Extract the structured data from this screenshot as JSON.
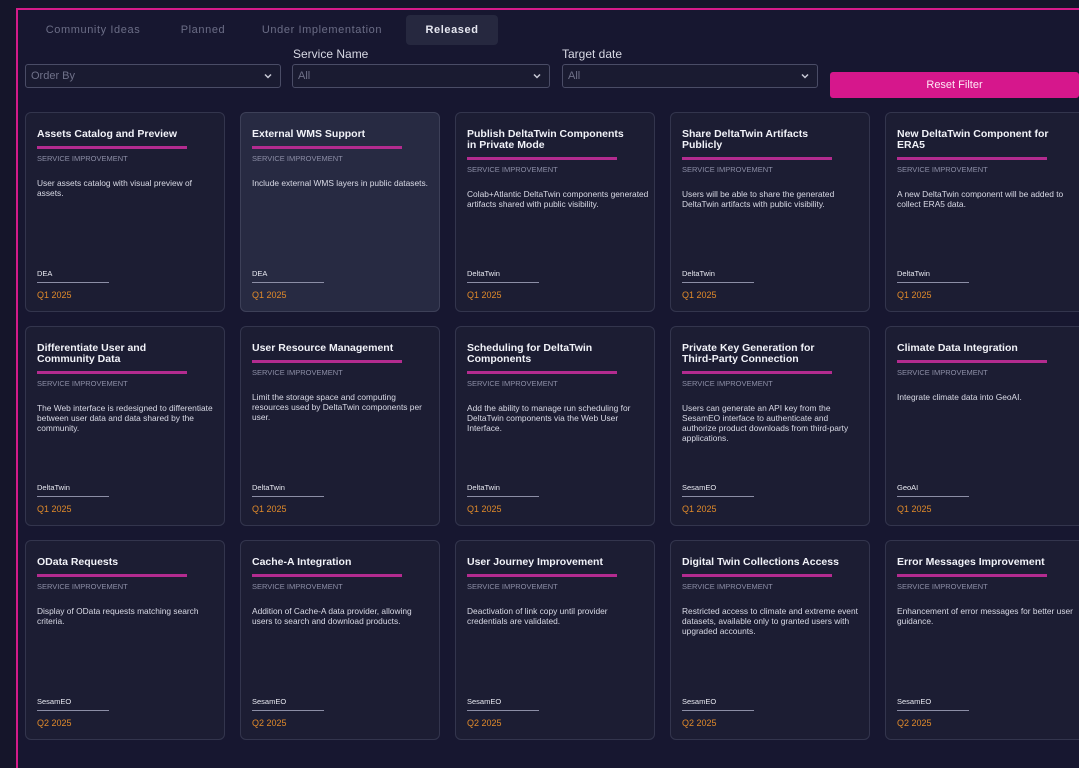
{
  "tabs": [
    {
      "label": "Community Ideas"
    },
    {
      "label": "Planned"
    },
    {
      "label": "Under Implementation"
    },
    {
      "label": "Released"
    }
  ],
  "filters": {
    "order_by": {
      "value": "Order By"
    },
    "service_name": {
      "label": "Service Name",
      "value": "All"
    },
    "target_date": {
      "label": "Target date",
      "value": "All"
    },
    "reset_label": "Reset Filter"
  },
  "cards": [
    {
      "title": "Assets Catalog and Preview",
      "category": "SERVICE IMPROVEMENT",
      "description": "User assets catalog with visual preview of assets.",
      "service": "DEA",
      "date": "Q1 2025"
    },
    {
      "title": "External WMS Support",
      "category": "SERVICE IMPROVEMENT",
      "description": "Include external WMS layers in public datasets.",
      "service": "DEA",
      "date": "Q1 2025"
    },
    {
      "title": "Publish DeltaTwin Components in Private Mode",
      "category": "SERVICE IMPROVEMENT",
      "description": "Colab+Atlantic DeltaTwin components generated artifacts shared with public visibility.",
      "service": "DeltaTwin",
      "date": "Q1 2025"
    },
    {
      "title": "Share DeltaTwin Artifacts Publicly",
      "category": "SERVICE IMPROVEMENT",
      "description": "Users will be able to share the generated DeltaTwin artifacts with public visibility.",
      "service": "DeltaTwin",
      "date": "Q1 2025"
    },
    {
      "title": "New DeltaTwin Component for ERA5",
      "category": "SERVICE IMPROVEMENT",
      "description": "A new DeltaTwin component will be added to collect ERA5 data.",
      "service": "DeltaTwin",
      "date": "Q1 2025"
    },
    {
      "title": "Differentiate User and Community Data",
      "category": "SERVICE IMPROVEMENT",
      "description": "The Web interface is redesigned to differentiate between user data and data shared by the community.",
      "service": "DeltaTwin",
      "date": "Q1 2025"
    },
    {
      "title": "User Resource Management",
      "category": "SERVICE IMPROVEMENT",
      "description": "Limit the storage space and computing resources used by DeltaTwin components per user.",
      "service": "DeltaTwin",
      "date": "Q1 2025"
    },
    {
      "title": "Scheduling for DeltaTwin Components",
      "category": "SERVICE IMPROVEMENT",
      "description": "Add the ability to manage run scheduling for DeltaTwin components via the Web User Interface.",
      "service": "DeltaTwin",
      "date": "Q1 2025"
    },
    {
      "title": "Private Key Generation for Third-Party Connection",
      "category": "SERVICE IMPROVEMENT",
      "description": "Users can generate an API key from the SesamEO interface to authenticate and authorize product downloads from third-party applications.",
      "service": "SesamEO",
      "date": "Q1 2025"
    },
    {
      "title": "Climate Data Integration",
      "category": "SERVICE IMPROVEMENT",
      "description": "Integrate climate data into GeoAI.",
      "service": "GeoAI",
      "date": "Q1 2025"
    },
    {
      "title": "OData Requests",
      "category": "SERVICE IMPROVEMENT",
      "description": "Display of OData requests matching search criteria.",
      "service": "SesamEO",
      "date": "Q2 2025"
    },
    {
      "title": "Cache-A Integration",
      "category": "SERVICE IMPROVEMENT",
      "description": "Addition of Cache-A data provider, allowing users to search and download products.",
      "service": "SesamEO",
      "date": "Q2 2025"
    },
    {
      "title": "User Journey Improvement",
      "category": "SERVICE IMPROVEMENT",
      "description": "Deactivation of link copy until provider credentials are validated.",
      "service": "SesamEO",
      "date": "Q2 2025"
    },
    {
      "title": "Digital Twin Collections Access",
      "category": "SERVICE IMPROVEMENT",
      "description": "Restricted access to climate and extreme event datasets, available only to granted users with upgraded accounts.",
      "service": "SesamEO",
      "date": "Q2 2025"
    },
    {
      "title": "Error Messages Improvement",
      "category": "SERVICE IMPROVEMENT",
      "description": "Enhancement of error messages for better user guidance.",
      "service": "SesamEO",
      "date": "Q2 2025"
    }
  ]
}
